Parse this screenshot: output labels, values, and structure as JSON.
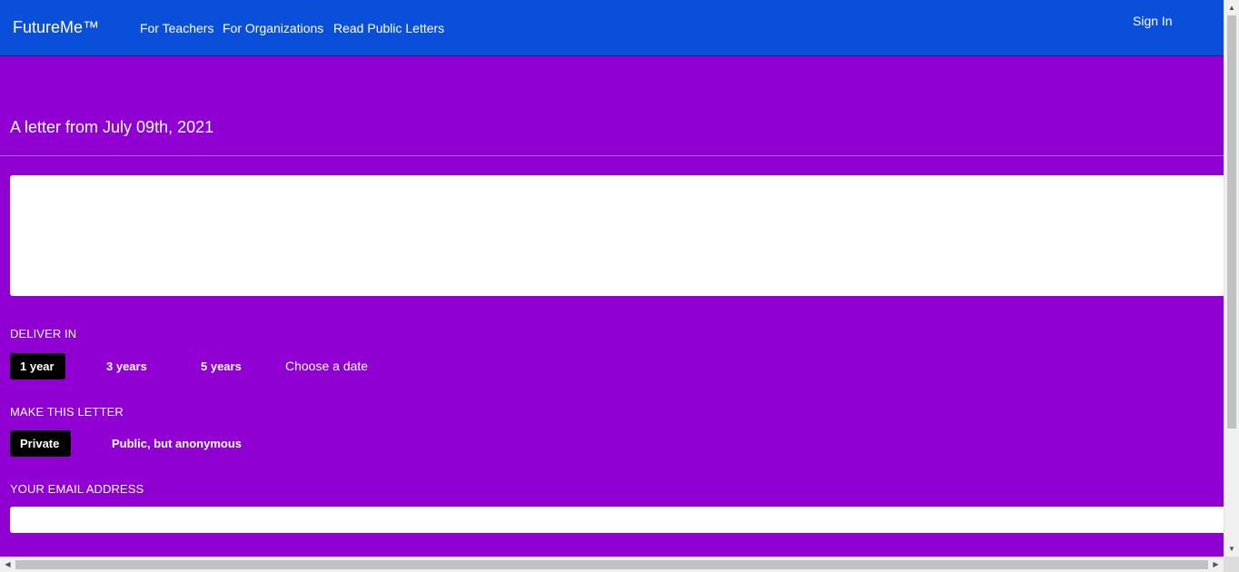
{
  "header": {
    "brand": "FutureMe™",
    "nav": [
      {
        "label": "For Teachers"
      },
      {
        "label": "For Organizations"
      },
      {
        "label": "Read Public Letters"
      }
    ],
    "sign_in": "Sign In"
  },
  "main": {
    "letter_heading": "A letter from July 09th, 2021",
    "letter_body": "",
    "deliver_in": {
      "label": "DELIVER IN",
      "options": [
        "1 year",
        "3 years",
        "5 years",
        "Choose a date"
      ],
      "selected": "1 year"
    },
    "visibility": {
      "label": "MAKE THIS LETTER",
      "options": [
        "Private",
        "Public, but anonymous"
      ],
      "selected": "Private"
    },
    "email": {
      "label": "YOUR EMAIL ADDRESS",
      "value": ""
    }
  },
  "icons": {
    "scroll_up": "arrow-up-icon",
    "scroll_down": "arrow-down-icon",
    "scroll_left": "arrow-left-icon",
    "scroll_right": "arrow-right-icon"
  },
  "colors": {
    "header_bg": "#0a4fd9",
    "page_bg": "#9000d2",
    "selected_option_bg": "#000000",
    "text": "#ffffff"
  }
}
